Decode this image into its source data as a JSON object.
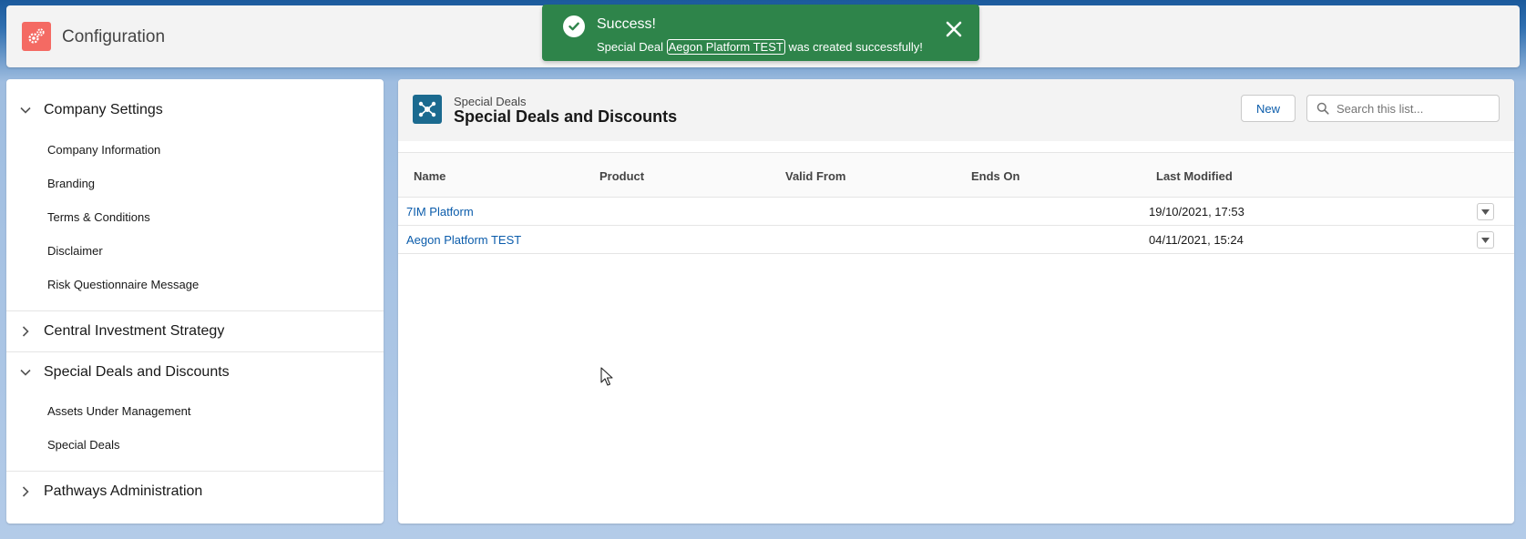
{
  "app": {
    "title": "Configuration"
  },
  "toast": {
    "title": "Success!",
    "message_prefix": "Special Deal ",
    "record_link": "Aegon Platform TEST",
    "message_suffix": " was created successfully!"
  },
  "sidebar": {
    "sections": [
      {
        "label": "Company Settings",
        "expanded": true,
        "items": [
          "Company Information",
          "Branding",
          "Terms & Conditions",
          "Disclaimer",
          "Risk Questionnaire Message"
        ]
      },
      {
        "label": "Central Investment Strategy",
        "expanded": false,
        "items": []
      },
      {
        "label": "Special Deals and Discounts",
        "expanded": true,
        "items": [
          "Assets Under Management",
          "Special Deals"
        ]
      },
      {
        "label": "Pathways Administration",
        "expanded": false,
        "items": []
      }
    ]
  },
  "list": {
    "object_label": "Special Deals",
    "title": "Special Deals and Discounts",
    "new_label": "New",
    "search_placeholder": "Search this list...",
    "columns": [
      "Name",
      "Product",
      "Valid From",
      "Ends On",
      "Last Modified"
    ],
    "rows": [
      {
        "name": "7IM Platform",
        "product": "",
        "valid_from": "",
        "ends_on": "",
        "last_modified": "19/10/2021, 17:53"
      },
      {
        "name": "Aegon Platform TEST",
        "product": "",
        "valid_from": "",
        "ends_on": "",
        "last_modified": "04/11/2021, 15:24"
      }
    ]
  },
  "colors": {
    "toast_success": "#2e844a",
    "brand_link": "#0b5cab",
    "app_icon": "#f46a63",
    "object_icon": "#1b6a8f"
  }
}
